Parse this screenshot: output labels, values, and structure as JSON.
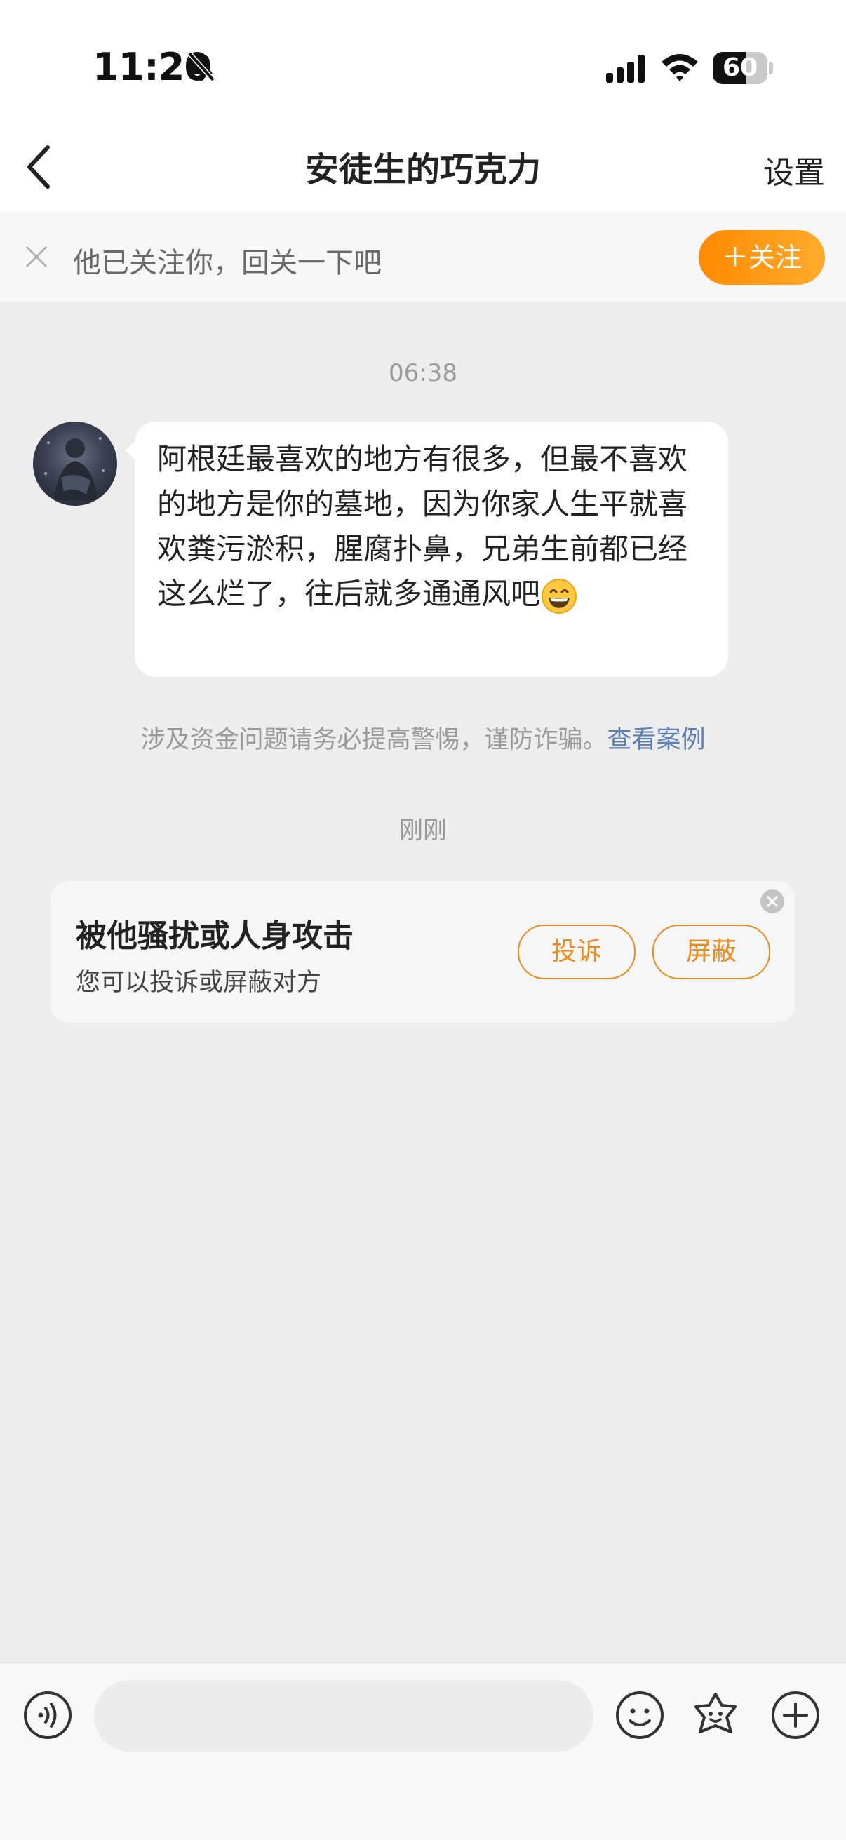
{
  "status_bar": {
    "time": "11:20",
    "battery": "60",
    "battery_level_percent": 60
  },
  "nav": {
    "title": "安徒生的巧克力",
    "settings_label": "设置"
  },
  "follow_bar": {
    "text": "他已关注你，回关一下吧",
    "button_label": "＋关注"
  },
  "chat": {
    "timestamp_1": "06:38",
    "message_1": {
      "text": "阿根廷最喜欢的地方有很多，但最不喜欢的地方是你的墓地，因为你家人生平就喜欢粪污淤积，腥腐扑鼻，兄弟生前都已经这么烂了，往后就多通通风吧",
      "emoji": "grinning-face-emoji"
    },
    "notice_text": "涉及资金问题请务必提高警惕，谨防诈骗。",
    "notice_link": "查看案例",
    "timestamp_2": "刚刚"
  },
  "report_card": {
    "title": "被他骚扰或人身攻击",
    "subtitle": "您可以投诉或屏蔽对方",
    "complain_label": "投诉",
    "block_label": "屏蔽"
  },
  "input_bar": {
    "icons": [
      "voice-icon",
      "emoji-icon",
      "sticker-icon",
      "plus-icon"
    ]
  },
  "colors": {
    "accent": "#ff8a00",
    "link": "#5a7fb3",
    "background": "#ededed"
  }
}
